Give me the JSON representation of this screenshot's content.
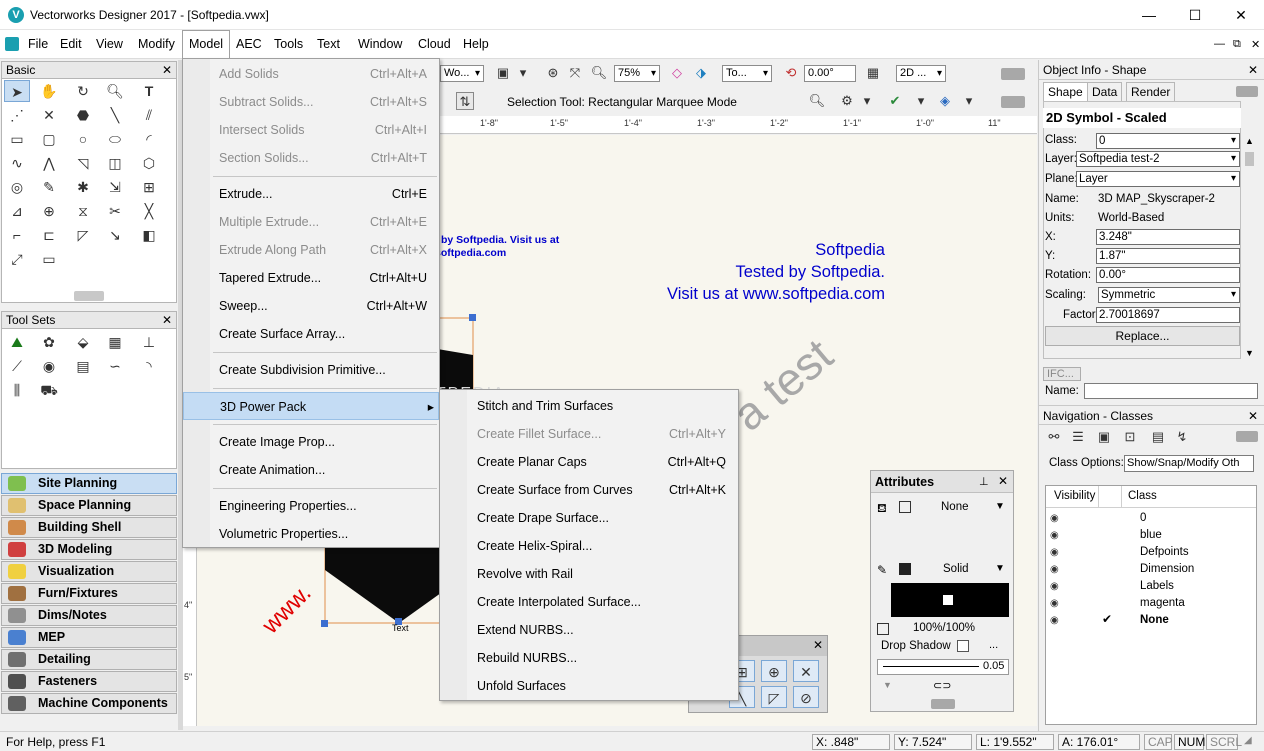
{
  "window": {
    "title": "Vectorworks Designer 2017 - [Softpedia.vwx]",
    "app_icon": "V",
    "minimize": "—",
    "maximize": "☐",
    "close": "✕"
  },
  "menubar": [
    "File",
    "Edit",
    "View",
    "Modify",
    "Model",
    "AEC",
    "Tools",
    "Text",
    "Window",
    "Cloud",
    "Help"
  ],
  "palettes": {
    "basic": {
      "title": "Basic",
      "close": "✕"
    },
    "toolsets": {
      "title": "Tool Sets",
      "close": "✕"
    },
    "workspaces": [
      "Site Planning",
      "Space Planning",
      "Building Shell",
      "3D Modeling",
      "Visualization",
      "Furn/Fixtures",
      "Dims/Notes",
      "MEP",
      "Detailing",
      "Fasteners",
      "Machine Components"
    ]
  },
  "viewbar": {
    "layer_field": "Wo...",
    "zoom": "75%",
    "view_field": "To...",
    "angle": "0.00°",
    "render_field": "2D ..."
  },
  "modebar": {
    "mode_text": "Selection Tool: Rectangular Marquee Mode"
  },
  "ruler_labels": [
    "1'-8\"",
    "1'-5\"",
    "1'-4\"",
    "1'-3\"",
    "1'-2\"",
    "1'-1\"",
    "1'-0\"",
    "11\""
  ],
  "vruler_labels": [
    "4\"",
    "5\""
  ],
  "drawing": {
    "blue_text_lines": [
      "Softpedia",
      "Tested by Softpedia.",
      "Visit us at www.softpedia.com"
    ],
    "small_text_1": "by Softpedia. Visit us at",
    "small_text_2": "softpedia.com",
    "watermark": "a test",
    "red_text": "www.",
    "text_label": "Text",
    "softpedia_mark": "SOFTPEDIA"
  },
  "model_menu": [
    {
      "label": "Add Solids",
      "accel": "Ctrl+Alt+A",
      "disabled": true
    },
    {
      "label": "Subtract Solids...",
      "accel": "Ctrl+Alt+S",
      "disabled": true
    },
    {
      "label": "Intersect Solids",
      "accel": "Ctrl+Alt+I",
      "disabled": true
    },
    {
      "label": "Section Solids...",
      "accel": "Ctrl+Alt+T",
      "disabled": true
    },
    {
      "label": "Extrude...",
      "accel": "Ctrl+E",
      "disabled": false
    },
    {
      "label": "Multiple Extrude...",
      "accel": "Ctrl+Alt+E",
      "disabled": true
    },
    {
      "label": "Extrude Along Path",
      "accel": "Ctrl+Alt+X",
      "disabled": true
    },
    {
      "label": "Tapered Extrude...",
      "accel": "Ctrl+Alt+U",
      "disabled": false
    },
    {
      "label": "Sweep...",
      "accel": "Ctrl+Alt+W",
      "disabled": false
    },
    {
      "label": "Create Surface Array...",
      "accel": "",
      "disabled": false
    },
    {
      "label": "Create Subdivision Primitive...",
      "accel": "",
      "disabled": false
    },
    {
      "label": "3D Power Pack",
      "accel": "",
      "disabled": false,
      "submenu": true
    },
    {
      "label": "Create Image Prop...",
      "accel": "",
      "disabled": false
    },
    {
      "label": "Create Animation...",
      "accel": "",
      "disabled": false
    },
    {
      "label": "Engineering Properties...",
      "accel": "",
      "disabled": false
    },
    {
      "label": "Volumetric Properties...",
      "accel": "",
      "disabled": false
    }
  ],
  "submenu_arrow": "▸",
  "power_pack_menu": [
    {
      "label": "Stitch and Trim Surfaces",
      "accel": "",
      "disabled": false
    },
    {
      "label": "Create Fillet Surface...",
      "accel": "Ctrl+Alt+Y",
      "disabled": true
    },
    {
      "label": "Create Planar Caps",
      "accel": "Ctrl+Alt+Q",
      "disabled": false
    },
    {
      "label": "Create Surface from Curves",
      "accel": "Ctrl+Alt+K",
      "disabled": false
    },
    {
      "label": "Create Drape Surface...",
      "accel": "",
      "disabled": false
    },
    {
      "label": "Create Helix-Spiral...",
      "accel": "",
      "disabled": false
    },
    {
      "label": "Revolve with Rail",
      "accel": "",
      "disabled": false
    },
    {
      "label": "Create Interpolated Surface...",
      "accel": "",
      "disabled": false
    },
    {
      "label": "Extend NURBS...",
      "accel": "",
      "disabled": false
    },
    {
      "label": "Rebuild NURBS...",
      "accel": "",
      "disabled": false
    },
    {
      "label": "Unfold Surfaces",
      "accel": "",
      "disabled": false
    }
  ],
  "object_info": {
    "title": "Object Info - Shape",
    "tabs": [
      "Shape",
      "Data",
      "Render"
    ],
    "heading": "2D Symbol - Scaled",
    "fields": [
      {
        "label": "Class:",
        "value": "0"
      },
      {
        "label": "Layer:",
        "value": "Softpedia test-2"
      },
      {
        "label": "Plane:",
        "value": "Layer"
      },
      {
        "label": "Name:",
        "value": "3D MAP_Skyscraper-2"
      },
      {
        "label": "Units:",
        "value": "World-Based"
      },
      {
        "label": "X:",
        "value": "3.248\""
      },
      {
        "label": "Y:",
        "value": "1.87\""
      },
      {
        "label": "Rotation:",
        "value": "0.00°"
      },
      {
        "label": "Scaling:",
        "value": "Symmetric"
      },
      {
        "label": "Factor:",
        "value": "2.70018697"
      }
    ],
    "replace_button": "Replace...",
    "ifc_button": "IFC...",
    "name_label": "Name:"
  },
  "navigation": {
    "title": "Navigation - Classes",
    "class_options_label": "Class Options:",
    "class_options_value": "Show/Snap/Modify Oth",
    "col_visibility": "Visibility",
    "col_class": "Class",
    "classes": [
      "0",
      "blue",
      "Defpoints",
      "Dimension",
      "Labels",
      "magenta",
      "None"
    ],
    "active_mark": "✔"
  },
  "attributes": {
    "title": "Attributes",
    "fill": "None",
    "pen": "Solid",
    "opacity": "100%/100%",
    "drop_shadow": "Drop Shadow",
    "line_weight": "0.05",
    "more": "..."
  },
  "status": {
    "help": "For Help, press F1",
    "x": "X: .848\"",
    "y": "Y: 7.524\"",
    "l": "L: 1'9.552\"",
    "a": "A: 176.01°",
    "cap": "CAP",
    "num": "NUM",
    "scrl": "SCRL"
  },
  "colors": {
    "accent_blue": "#0000cc",
    "red_text": "#e00000",
    "shape_black": "#0b0b0b",
    "highlight": "#c4dcf4"
  }
}
